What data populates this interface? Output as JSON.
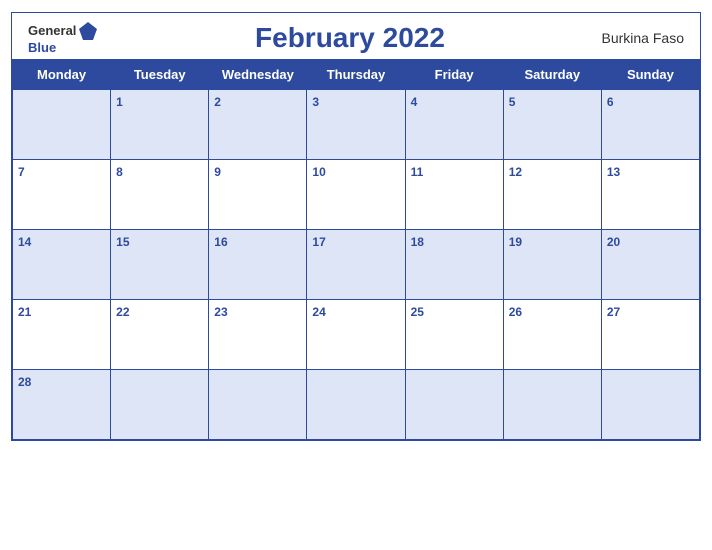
{
  "header": {
    "logo_general": "General",
    "logo_blue": "Blue",
    "title": "February 2022",
    "country": "Burkina Faso"
  },
  "weekdays": [
    "Monday",
    "Tuesday",
    "Wednesday",
    "Thursday",
    "Friday",
    "Saturday",
    "Sunday"
  ],
  "weeks": [
    [
      "",
      "1",
      "2",
      "3",
      "4",
      "5",
      "6"
    ],
    [
      "7",
      "8",
      "9",
      "10",
      "11",
      "12",
      "13"
    ],
    [
      "14",
      "15",
      "16",
      "17",
      "18",
      "19",
      "20"
    ],
    [
      "21",
      "22",
      "23",
      "24",
      "25",
      "26",
      "27"
    ],
    [
      "28",
      "",
      "",
      "",
      "",
      "",
      ""
    ]
  ]
}
